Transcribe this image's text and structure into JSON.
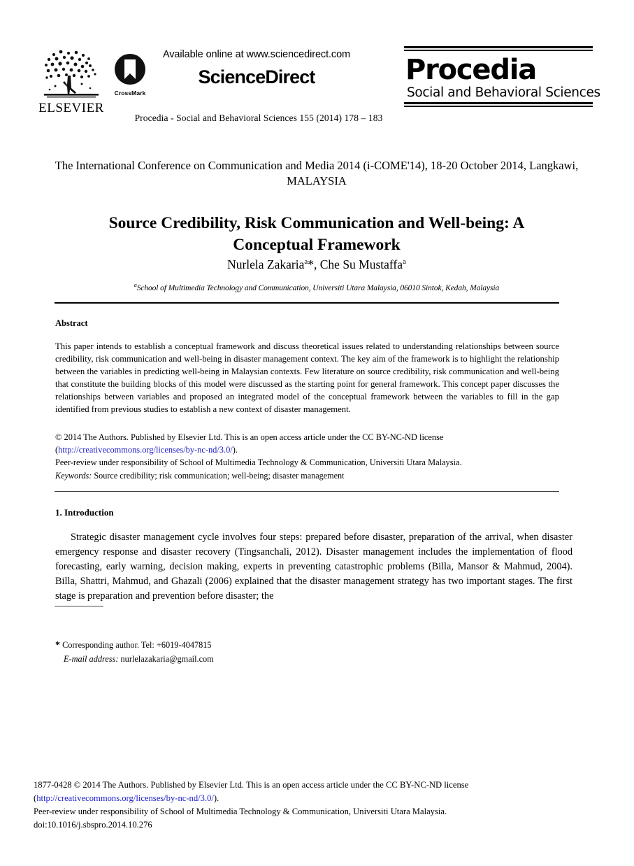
{
  "masthead": {
    "elsevier_wordmark": "ELSEVIER",
    "crossmark_label": "CrossMark",
    "available_online": "Available online at www.sciencedirect.com",
    "sciencedirect_wordmark": "ScienceDirect",
    "procedia_title": "Procedia",
    "procedia_subtitle": "Social and Behavioral Sciences",
    "journal_reference": "Procedia - Social and Behavioral Sciences 155 (2014) 178 – 183"
  },
  "article": {
    "conference": "The International Conference on Communication and Media 2014 (i-COME'14), 18-20 October 2014, Langkawi, MALAYSIA",
    "title": "Source Credibility, Risk Communication and Well-being: A Conceptual Framework",
    "authors_html": "Nurlela Zakaria<sup>a</sup>*, Che Su Mustaffa<sup>a</sup>",
    "affiliation_html": "<sup>a</sup>School of Multimedia Technology and Communication, Universiti Utara Malaysia, 06010 Sintok, Kedah, Malaysia"
  },
  "abstract": {
    "heading": "Abstract",
    "text": "This paper intends to establish a conceptual framework and discuss theoretical issues related to understanding relationships between source credibility, risk communication and well-being in disaster management context.  The key aim of the framework is to highlight the relationship between the variables in predicting well-being in Malaysian contexts. Few literature on source credibility, risk communication and well-being that constitute the building blocks of this model were discussed as the starting point for general framework. This concept paper discusses the relationships between variables and proposed an integrated model of the conceptual framework between the variables to fill in the gap identified from previous studies to establish a new context of disaster management.",
    "copyright_line": "© 2014 The Authors. Published by Elsevier Ltd. This is an open access article under the CC BY-NC-ND license",
    "license_url": "http://creativecommons.org/licenses/by-nc-nd/3.0/",
    "peer_review_line": "Peer-review under responsibility of School of Multimedia Technology & Communication, Universiti Utara Malaysia.",
    "keywords_label": "Keywords:",
    "keywords_text": "Source credibility; risk communication; well-being; disaster management"
  },
  "introduction": {
    "heading": "1. Introduction",
    "paragraph": "Strategic disaster management cycle involves four steps: prepared before disaster, preparation of the arrival, when disaster emergency response and disaster recovery (Tingsanchali, 2012). Disaster management includes the implementation of flood forecasting, early warning, decision making, experts in preventing catastrophic problems (Billa, Mansor & Mahmud, 2004). Billa, Shattri, Mahmud, and Ghazali (2006) explained that the disaster management strategy has two important stages. The first stage is preparation and prevention before disaster; the"
  },
  "footnote": {
    "corresponding_author": "Corresponding author. Tel: +6019-4047815",
    "email_label": "E-mail address:",
    "email": "nurlelazakaria@gmail.com"
  },
  "footer": {
    "issn_copyright_line": "1877-0428 © 2014 The Authors. Published by Elsevier Ltd. This is an open access article under the CC BY-NC-ND license",
    "license_url": "http://creativecommons.org/licenses/by-nc-nd/3.0/",
    "peer_review_line": "Peer-review under responsibility of School of Multimedia Technology & Communication, Universiti Utara Malaysia.",
    "doi": "doi:10.1016/j.sbspro.2014.10.276"
  },
  "colors": {
    "link": "#2020cc",
    "text": "#000000",
    "rule": "#000000"
  }
}
